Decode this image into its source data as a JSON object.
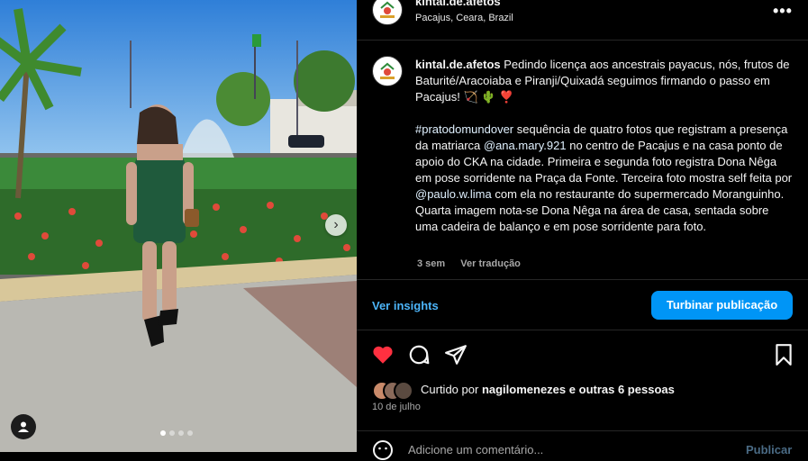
{
  "post": {
    "account": "kintal.de.afetos",
    "location": "Pacajus, Ceara, Brazil",
    "caption_line1": "Pedindo licença aos ancestrais payacus, nós, frutos de Baturité/Aracoiaba e Piranji/Quixadá seguimos firmando o passo em Pacajus! 🏹 🌵 ❣️",
    "hashtag": "#pratodomundover",
    "caption_a": " sequência de quatro fotos que registram a presença da matriarca ",
    "mention1": "@ana.mary.921",
    "caption_b": " no centro de Pacajus e na casa ponto de apoio do CKA na cidade. Primeira e segunda foto registra Dona Nêga em pose sorridente na Praça da Fonte. Terceira foto mostra self feita por ",
    "mention2": "@paulo.w.lima",
    "caption_c": " com ela no restaurante do supermercado Moranguinho. Quarta imagem nota-se Dona Nêga na área de casa, sentada sobre uma cadeira de balanço e em pose sorridente para foto.",
    "age": "3 sem",
    "see_translation": "Ver tradução",
    "liked_prefix": "Curtido por",
    "liked_user": "nagilomenezes",
    "liked_mid": "e",
    "liked_others": "outras 6 pessoas",
    "date": "10 de julho",
    "comment_placeholder": "Adicione um comentário...",
    "publish_label": "Publicar"
  },
  "buttons": {
    "insights": "Ver insights",
    "boost": "Turbinar publicação",
    "more": "•••",
    "carousel_next": "›"
  },
  "colors": {
    "link_blue": "#4cb5f9",
    "button_blue": "#0095f6",
    "like_red": "#ff3040"
  },
  "icons": {
    "like": "heart-icon",
    "comment": "comment-icon",
    "share": "share-icon",
    "save": "bookmark-icon",
    "tag": "user-tag-icon",
    "emoji": "emoji-icon"
  }
}
